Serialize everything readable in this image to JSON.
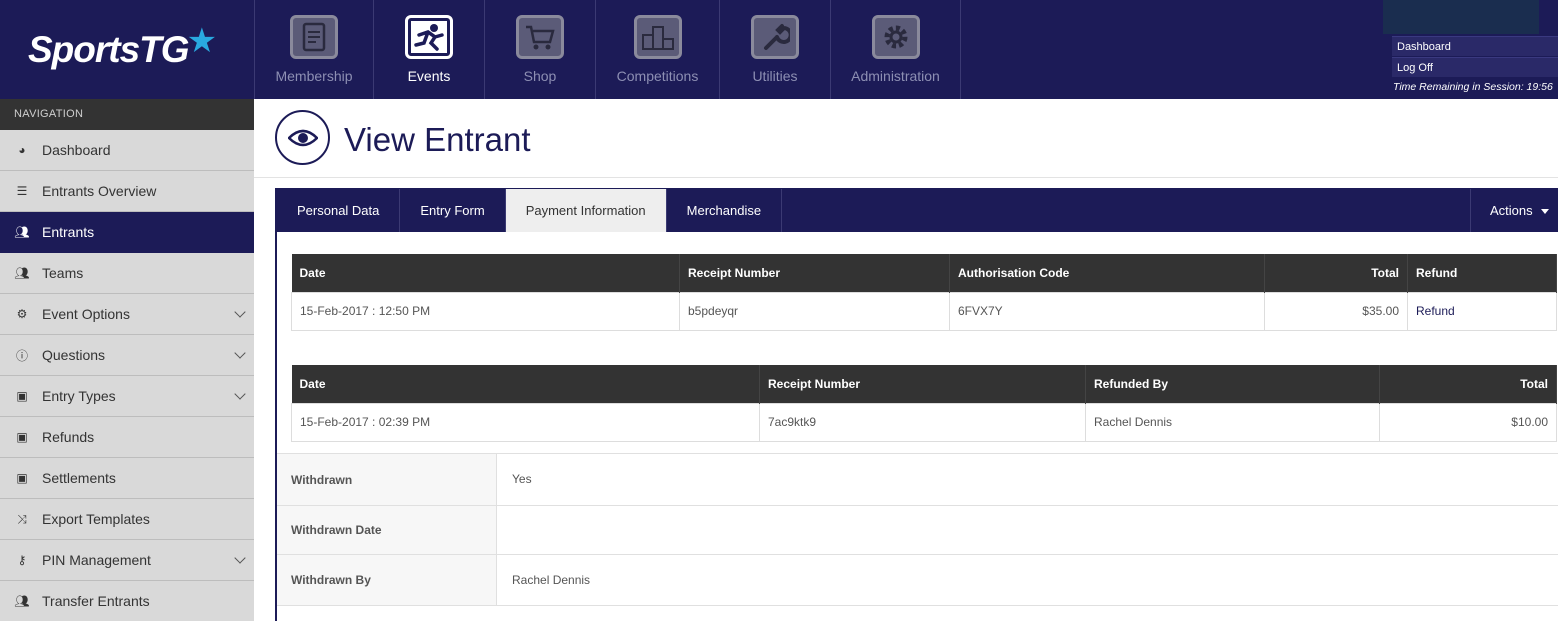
{
  "brand": {
    "name": "SportsTG"
  },
  "modules": [
    {
      "label": "Membership",
      "icon": "clipboard-icon"
    },
    {
      "label": "Events",
      "icon": "runner-icon"
    },
    {
      "label": "Shop",
      "icon": "cart-icon"
    },
    {
      "label": "Competitions",
      "icon": "podium-icon"
    },
    {
      "label": "Utilities",
      "icon": "wrench-icon"
    },
    {
      "label": "Administration",
      "icon": "gear-icon"
    }
  ],
  "session": {
    "dashboard": "Dashboard",
    "logoff": "Log Off",
    "time": "Time Remaining in Session: 19:56"
  },
  "nav": {
    "header": "NAVIGATION",
    "items": [
      {
        "label": "Dashboard"
      },
      {
        "label": "Entrants Overview"
      },
      {
        "label": "Entrants"
      },
      {
        "label": "Teams"
      },
      {
        "label": "Event Options"
      },
      {
        "label": "Questions"
      },
      {
        "label": "Entry Types"
      },
      {
        "label": "Refunds"
      },
      {
        "label": "Settlements"
      },
      {
        "label": "Export Templates"
      },
      {
        "label": "PIN Management"
      },
      {
        "label": "Transfer Entrants"
      }
    ]
  },
  "page": {
    "title": "View Entrant"
  },
  "tabs": [
    "Personal Data",
    "Entry Form",
    "Payment Information",
    "Merchandise"
  ],
  "actions": "Actions",
  "payments": {
    "headers": [
      "Date",
      "Receipt Number",
      "Authorisation Code",
      "Total",
      "Refund"
    ],
    "rows": [
      [
        "15-Feb-2017 : 12:50 PM",
        "b5pdeyqr",
        "6FVX7Y",
        "$35.00",
        "Refund"
      ]
    ]
  },
  "refunds": {
    "headers": [
      "Date",
      "Receipt Number",
      "Refunded By",
      "Total"
    ],
    "rows": [
      [
        "15-Feb-2017 : 02:39 PM",
        "7ac9ktk9",
        "Rachel Dennis",
        "$10.00"
      ]
    ]
  },
  "withdrawal": {
    "withdrawn_label": "Withdrawn",
    "withdrawn_value": "Yes",
    "date_label": "Withdrawn Date",
    "date_value": "",
    "by_label": "Withdrawn By",
    "by_value": "Rachel Dennis"
  }
}
